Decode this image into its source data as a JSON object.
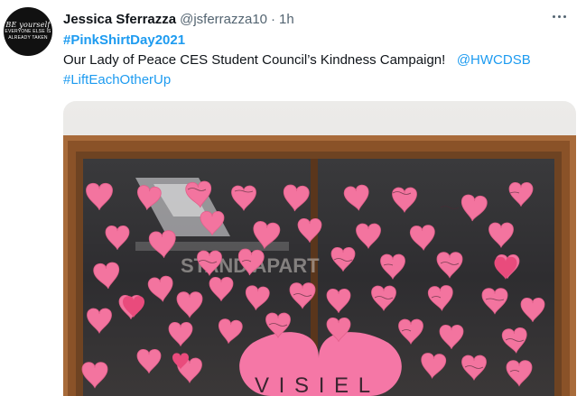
{
  "tweet": {
    "author_name": "Jessica Sferrazza",
    "author_handle": "@jsferrazza10",
    "separator": "·",
    "time": "1h",
    "more_icon": "more-horizontal-icon",
    "avatar": {
      "line1": "BE yourself",
      "line2": "EVERYONE ELSE IS",
      "line3": "ALREADY TAKEN"
    },
    "hashtag_title": "#PinkShirtDay2021",
    "text": "Our Lady of Peace CES Student Council’s Kindness Campaign!",
    "mention": "@HWCDSB",
    "hashtag_footer": "#LiftEachOtherUp",
    "link_color": "#1d9bf0"
  },
  "photo": {
    "background_sign_text": "STAND APART",
    "big_heart_text": "V I S I E L"
  }
}
